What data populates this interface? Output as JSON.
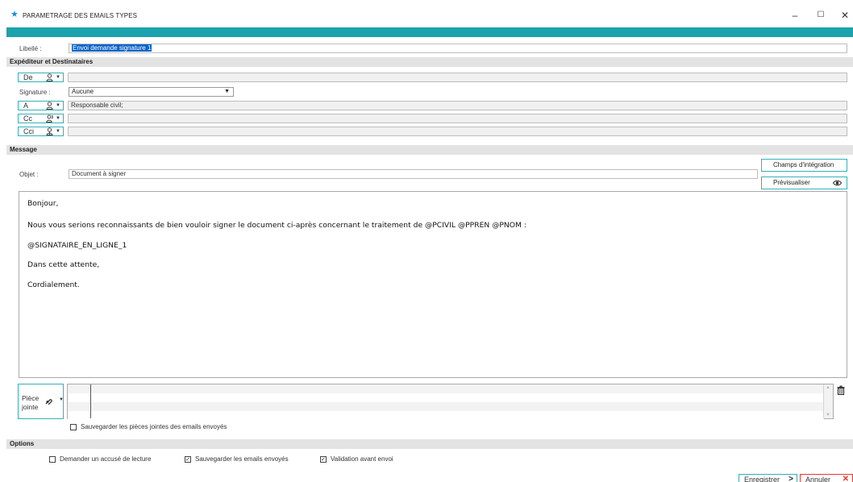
{
  "window": {
    "title": "PARAMETRAGE DES EMAILS TYPES",
    "minimize": "–",
    "maximize": "☐",
    "close": "✕"
  },
  "libelle": {
    "label": "Libellé :",
    "value": "Envoi demande signature 1"
  },
  "expediteur": {
    "section_title": "Expéditeur et Destinataires",
    "de": {
      "button": "De",
      "value": ""
    },
    "signature": {
      "label": "Signature :",
      "value": "Aucune"
    },
    "a": {
      "button": "A",
      "value": "Responsable civil;"
    },
    "cc": {
      "button": "Cc",
      "value": ""
    },
    "cci": {
      "button": "Cci",
      "value": ""
    }
  },
  "message": {
    "section_title": "Message",
    "objet_label": "Objet :",
    "objet_value": "Document à signer",
    "champs_button": "Champs d'intégration",
    "preview_button": "Prévisualiser",
    "body": [
      "Bonjour,",
      "Nous vous serions reconnaissants de bien vouloir signer le document ci-après concernant le traitement de @PCIVIL @PPREN @PNOM :",
      "@SIGNATAIRE_EN_LIGNE_1",
      "Dans cette attente,",
      "Cordialement."
    ],
    "piece_jointe_line1": "Pièce",
    "piece_jointe_line2": "jointe",
    "save_attachments": {
      "label": "Sauvegarder les pièces jointes des emails envoyés",
      "checked": false
    }
  },
  "options": {
    "section_title": "Options",
    "accuse": {
      "label": "Demander un accusé de lecture",
      "checked": false
    },
    "sauvegarder": {
      "label": "Sauvegarder les emails envoyés",
      "checked": true
    },
    "validation": {
      "label": "Validation avant envoi",
      "checked": true
    }
  },
  "footer": {
    "save": "Enregistrer",
    "cancel": "Annuler"
  },
  "colors": {
    "accent": "#1aa3ad",
    "selection": "#0a63c7",
    "cancel": "#e53935",
    "star": "#1a8fd8"
  }
}
